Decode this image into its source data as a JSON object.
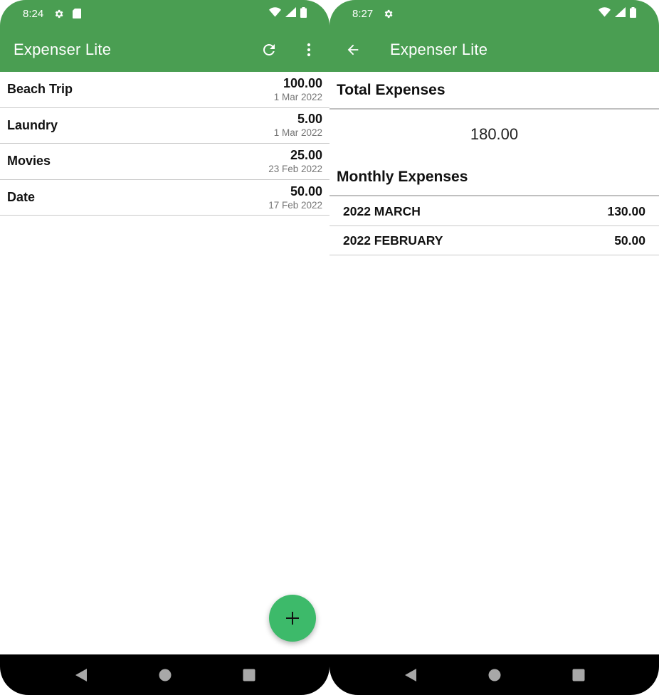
{
  "left": {
    "status": {
      "time": "8:24"
    },
    "appbar": {
      "title": "Expenser Lite"
    },
    "expenses": [
      {
        "name": "Beach Trip",
        "amount": "100.00",
        "date": "1 Mar 2022"
      },
      {
        "name": "Laundry",
        "amount": "5.00",
        "date": "1 Mar 2022"
      },
      {
        "name": "Movies",
        "amount": "25.00",
        "date": "23 Feb 2022"
      },
      {
        "name": "Date",
        "amount": "50.00",
        "date": "17 Feb 2022"
      }
    ]
  },
  "right": {
    "status": {
      "time": "8:27"
    },
    "appbar": {
      "title": "Expenser Lite"
    },
    "total": {
      "heading": "Total Expenses",
      "value": "180.00"
    },
    "monthly": {
      "heading": "Monthly Expenses",
      "rows": [
        {
          "month": "2022 MARCH",
          "amount": "130.00"
        },
        {
          "month": "2022 FEBRUARY",
          "amount": "50.00"
        }
      ]
    }
  },
  "icons": {
    "settings": "gear-icon",
    "sd_card": "sd-card-icon",
    "wifi": "wifi-icon",
    "signal": "signal-icon",
    "battery": "battery-icon",
    "refresh": "refresh-icon",
    "more": "more-vert-icon",
    "back": "arrow-back-icon",
    "add": "plus-icon",
    "nav_back": "nav-back-icon",
    "nav_home": "nav-home-icon",
    "nav_recents": "nav-recents-icon"
  },
  "colors": {
    "appbar": "#4a9e52",
    "fab": "#3dba6a",
    "date_text": "#757575",
    "navbar": "#000000"
  }
}
